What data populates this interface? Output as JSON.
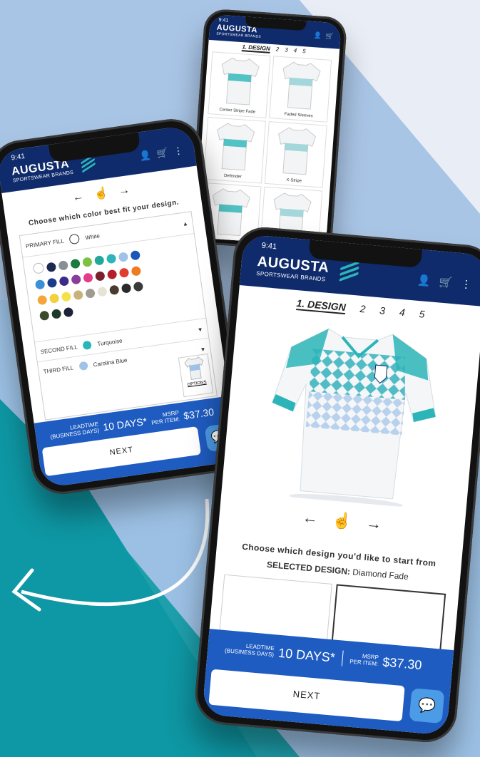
{
  "colors": {
    "navy": "#0f2b6b",
    "blue": "#1f5cc1",
    "teal": "#2bb5b9",
    "chat": "#4c9be6"
  },
  "brand": {
    "name": "AUGUSTA",
    "sub": "SPORTSWEAR BRANDS"
  },
  "status": {
    "time": "9:41"
  },
  "steps": {
    "active": "1. DESIGN",
    "others": [
      "2",
      "3",
      "4",
      "5"
    ]
  },
  "main": {
    "arrow_left": "←",
    "arrow_right": "→",
    "prompt": "Choose which design you'd like to start from",
    "selected_label": "SELECTED DESIGN:",
    "selected_value": "Diamond Fade"
  },
  "footer": {
    "lead_label_1": "LEADTIME",
    "lead_label_2": "(BUSINESS DAYS)",
    "lead_value": "10 DAYS*",
    "msrp_label_1": "MSRP",
    "msrp_label_2": "PER ITEM:",
    "price": "$37.30",
    "next": "NEXT"
  },
  "color_screen": {
    "prompt": "Choose which color best fit your design.",
    "primary_label": "PRIMARY FILL",
    "primary_value": "White",
    "second_label": "SECOND FILL",
    "second_value": "Turquoise",
    "third_label": "THIRD FILL",
    "third_value": "Carolina Blue",
    "options": "OPTIONS",
    "swatches": [
      "#ffffff",
      "#1c2a52",
      "#8a8f96",
      "#1b7a3f",
      "#7cc142",
      "#22a89a",
      "#2bb5b9",
      "#9ec3e6",
      "#1a57b8",
      "#3a8fd6",
      "#1a3a8a",
      "#3b2c8a",
      "#8a3c9a",
      "#e13d8a",
      "#7a1f2b",
      "#b4202a",
      "#e23b2f",
      "#f07a1f",
      "#f4a63a",
      "#f2d13c",
      "#f6e04a",
      "#c8b27a",
      "#a09a90",
      "#e6e2d6",
      "#4a3a30",
      "#2a2a2a",
      "#3a3a3a",
      "#3b4a2a",
      "#1f3a2a",
      "#1e2238"
    ],
    "primary_dot": "#ffffff",
    "second_dot": "#2bb5b9",
    "third_dot": "#9ec3e6"
  },
  "grid_screen": {
    "tiles": [
      "Center Stripe Fade",
      "Faded Sleeves",
      "Defender",
      "X-Stripe",
      "",
      ""
    ]
  }
}
